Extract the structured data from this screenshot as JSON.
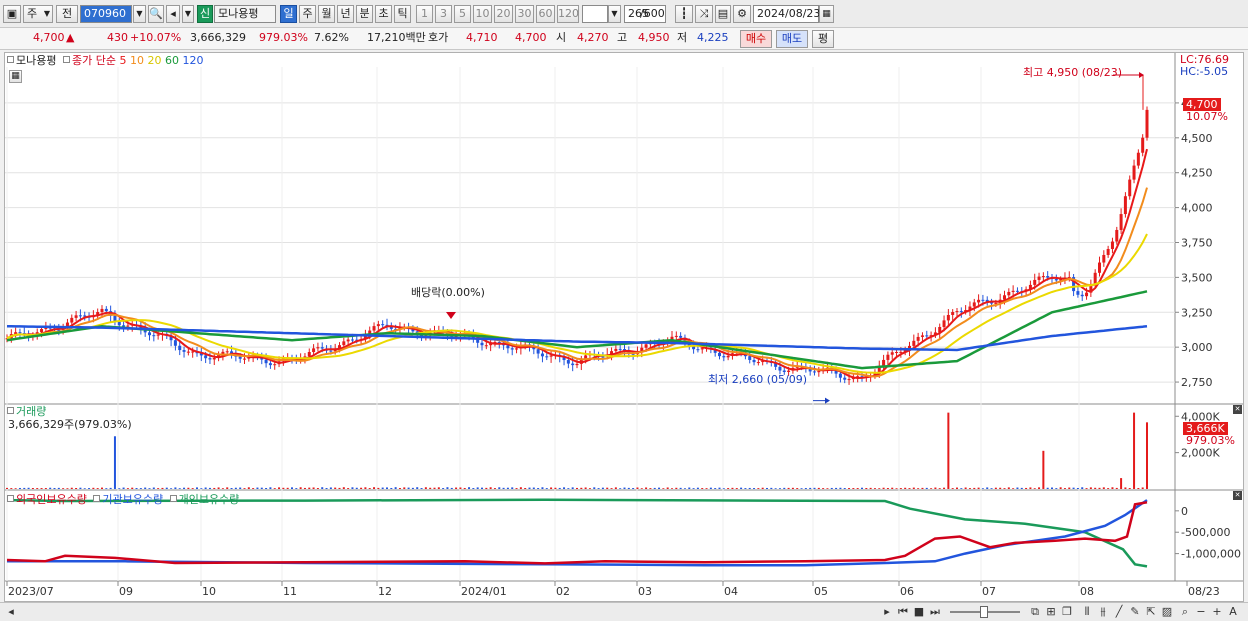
{
  "toolbar": {
    "market": "주",
    "prev": "전",
    "code": "070960",
    "badge": "신",
    "name": "모나용평",
    "periods": [
      "일",
      "주",
      "월",
      "년",
      "분",
      "초",
      "틱"
    ],
    "intervals": [
      "1",
      "3",
      "5",
      "10",
      "20",
      "30",
      "60",
      "120"
    ],
    "count": "265",
    "count_total": "/600",
    "date": "2024/08/23"
  },
  "quote": {
    "price": "4,700",
    "change": "430",
    "change_pct": "+10.07%",
    "volume": "3,666,329",
    "vol_ratio": "979.03%",
    "turnover": "7.62%",
    "amount": "17,210백만",
    "bid_label": "호가",
    "bid1": "4,710",
    "bid2": "4,700",
    "open_label": "시",
    "open": "4,270",
    "high_label": "고",
    "high": "4,950",
    "low_label": "저",
    "low": "4,225",
    "buy": "매수",
    "sell": "매도",
    "eval": "평"
  },
  "price_panel": {
    "name": "모나용평",
    "ma_label": "종가 단순",
    "ma": [
      {
        "period": "5",
        "color": "#e81919"
      },
      {
        "period": "10",
        "color": "#f28c1c"
      },
      {
        "period": "20",
        "color": "#ebd900"
      },
      {
        "period": "60",
        "color": "#1a9a3b"
      },
      {
        "period": "120",
        "color": "#2255dd"
      }
    ],
    "lc": "LC:76.69",
    "hc": "HC:-5.05",
    "last_price": "4,700",
    "last_pct": "10.07%",
    "high_note": "최고 4,950 (08/23)",
    "low_note": "최저 2,660 (05/09)",
    "dividend_note": "배당락(0.00%)",
    "y_ticks": [
      "4,750",
      "4,500",
      "4,250",
      "4,000",
      "3,750",
      "3,500",
      "3,250",
      "3,000",
      "2,750"
    ]
  },
  "volume_panel": {
    "title": "거래량",
    "value": "3,666,329주(979.03%)",
    "last": "3,666K",
    "last_pct": "979.03%",
    "y_ticks": [
      "4,000K",
      "2,000K"
    ]
  },
  "holding_panel": {
    "series": [
      {
        "name": "외국인보유수량",
        "color": "#d0021b"
      },
      {
        "name": "기관보유수량",
        "color": "#2255dd"
      },
      {
        "name": "개인보유수량",
        "color": "#1a9a5a"
      }
    ],
    "y_ticks": [
      "0",
      "-500,000",
      "-1,000,000"
    ]
  },
  "x_labels": [
    "2023/07",
    "09",
    "10",
    "11",
    "12",
    "2024/01",
    "02",
    "03",
    "04",
    "05",
    "06",
    "07",
    "08",
    "08/23"
  ],
  "chart_data": {
    "type": "line",
    "title": "모나용평",
    "x": [
      "2023/07",
      "09",
      "10",
      "11",
      "12",
      "2024/01",
      "02",
      "03",
      "04",
      "05",
      "06",
      "07",
      "08",
      "08/23"
    ],
    "series": [
      {
        "name": "종가",
        "values": [
          3050,
          3250,
          2950,
          2900,
          3150,
          3050,
          2900,
          3050,
          2880,
          2780,
          3250,
          3500,
          3450,
          4700
        ]
      },
      {
        "name": "5",
        "values": [
          3050,
          3250,
          2950,
          2920,
          3150,
          3050,
          2900,
          3050,
          2880,
          2790,
          3250,
          3500,
          3450,
          4600
        ]
      },
      {
        "name": "60",
        "values": [
          3050,
          3150,
          3100,
          3050,
          3100,
          3080,
          3000,
          3050,
          2950,
          2850,
          2900,
          3250,
          3400,
          3520
        ]
      },
      {
        "name": "120",
        "values": [
          3150,
          3140,
          3120,
          3100,
          3080,
          3060,
          3040,
          3030,
          3010,
          2990,
          2980,
          3080,
          3150,
          3220
        ]
      }
    ],
    "ylim": [
      2600,
      4950
    ],
    "high": {
      "value": 4950,
      "date": "08/23"
    },
    "low": {
      "value": 2660,
      "date": "05/09"
    }
  }
}
